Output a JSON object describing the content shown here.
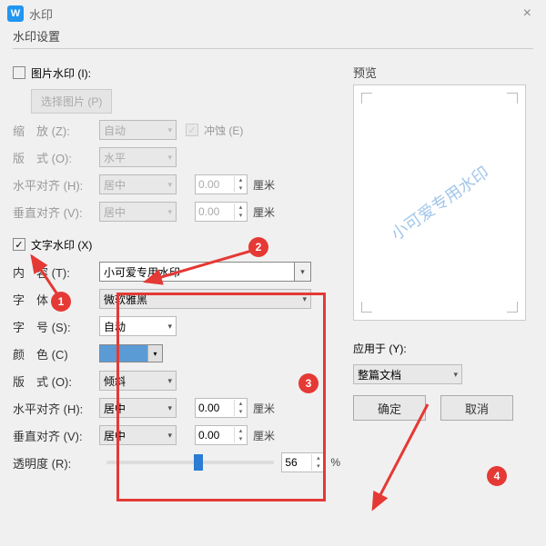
{
  "window": {
    "title": "水印",
    "icon_letter": "W"
  },
  "fieldset": {
    "label": "水印设置"
  },
  "image_wm": {
    "checkbox_label": "图片水印 (I):",
    "select_btn": "选择图片 (P)"
  },
  "zoom": {
    "label": "缩　放 (Z):",
    "value": "自动",
    "washout_label": "冲蚀 (E)"
  },
  "layout1": {
    "label": "版　式 (O):",
    "value": "水平"
  },
  "halign1": {
    "label": "水平对齐 (H):",
    "value": "居中",
    "num": "0.00",
    "unit": "厘米"
  },
  "valign1": {
    "label": "垂直对齐 (V):",
    "value": "居中",
    "num": "0.00",
    "unit": "厘米"
  },
  "text_wm": {
    "checkbox_label": "文字水印 (X)",
    "checked": "✓"
  },
  "content_f": {
    "label": "内　容 (T):",
    "value": "小可爱专用水印"
  },
  "font_f": {
    "label": "字　体 (F):",
    "value": "微软雅黑"
  },
  "size_f": {
    "label": "字　号 (S):",
    "value": "自动"
  },
  "color_f": {
    "label": "颜　色 (C)"
  },
  "layout2": {
    "label": "版　式 (O):",
    "value": "倾斜"
  },
  "halign2": {
    "label": "水平对齐 (H):",
    "value": "居中",
    "num": "0.00",
    "unit": "厘米"
  },
  "valign2": {
    "label": "垂直对齐 (V):",
    "value": "居中",
    "num": "0.00",
    "unit": "厘米"
  },
  "opacity": {
    "label": "透明度 (R):",
    "value": "56",
    "unit": "%"
  },
  "preview": {
    "label": "预览",
    "watermark": "小可爱专用水印"
  },
  "apply": {
    "label": "应用于 (Y):",
    "value": "整篇文档"
  },
  "buttons": {
    "ok": "确定",
    "cancel": "取消"
  },
  "badges": {
    "b1": "1",
    "b2": "2",
    "b3": "3",
    "b4": "4"
  }
}
